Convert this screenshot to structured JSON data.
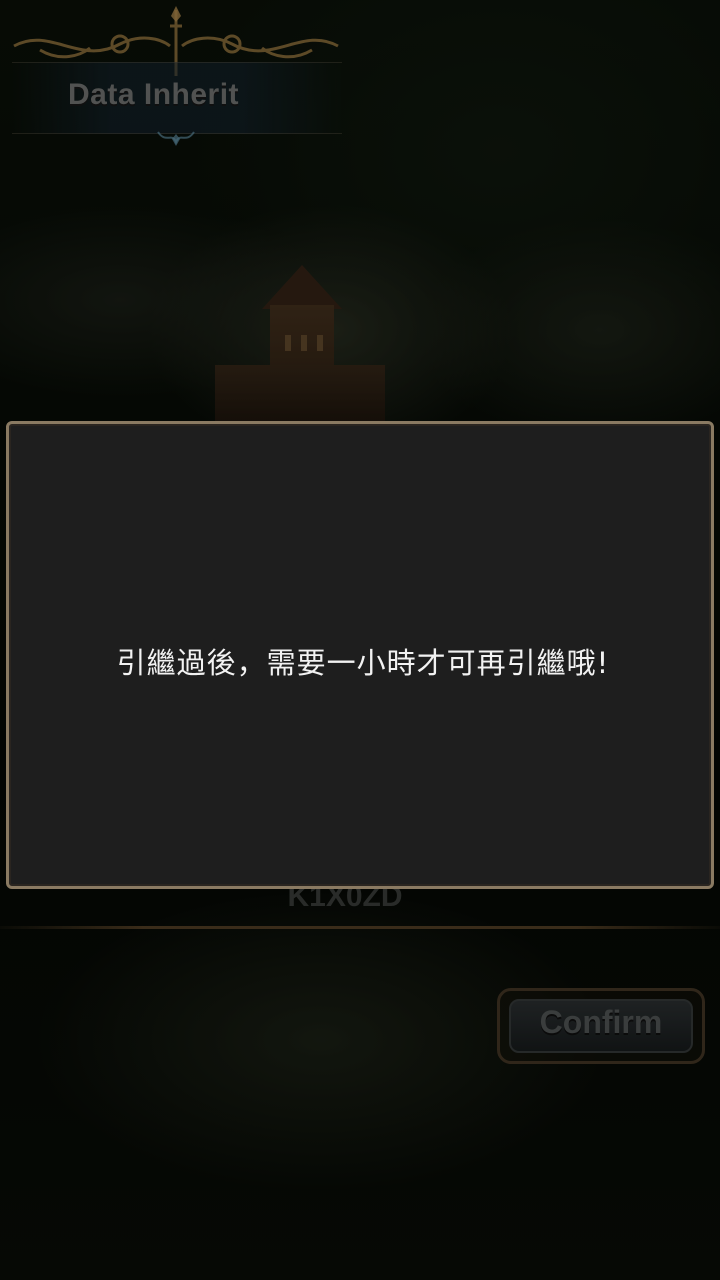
{
  "header": {
    "title": "Data Inherit"
  },
  "code": {
    "value": "K1X0ZD"
  },
  "confirm_button": {
    "label": "Confirm"
  },
  "dialog": {
    "message": "引繼過後，需要一小時才可再引繼哦!"
  },
  "colors": {
    "dialog_bg": "#1e1e1e",
    "dialog_border": "#8a7a62",
    "ornament_gold": "#b08a4a"
  }
}
